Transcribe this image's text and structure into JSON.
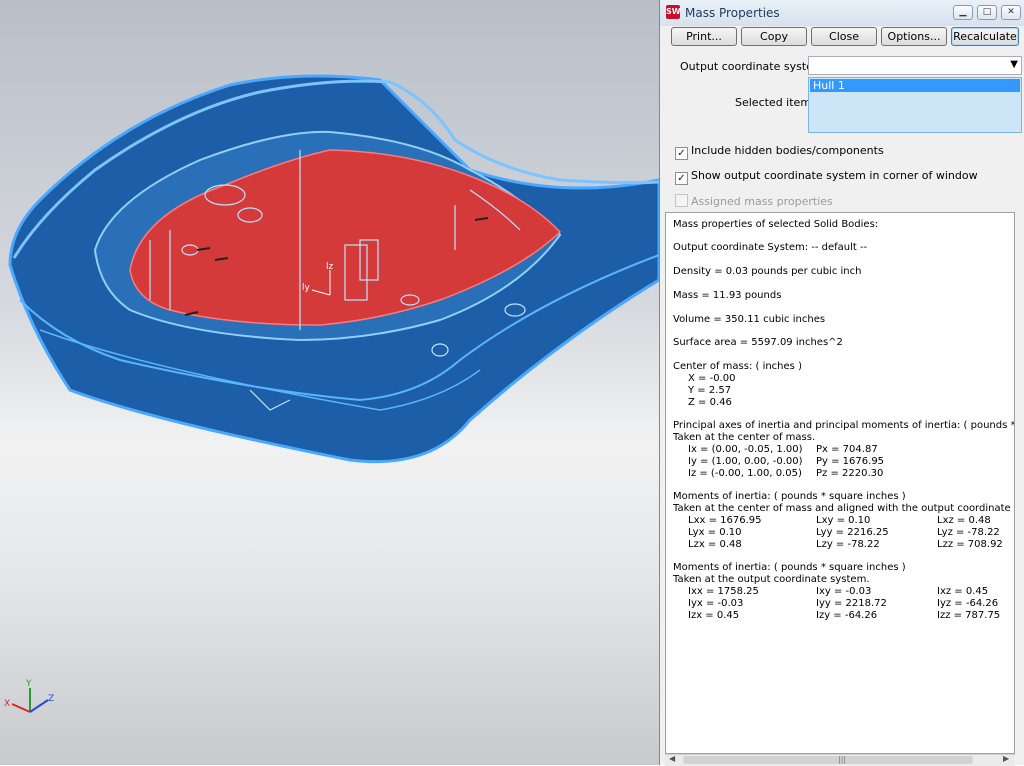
{
  "window": {
    "title": "Mass Properties",
    "app_icon": "SW"
  },
  "toolbar": {
    "print": "Print...",
    "copy": "Copy",
    "close": "Close",
    "options": "Options...",
    "recalculate": "Recalculate"
  },
  "form": {
    "output_coord_label": "Output coordinate system:",
    "output_coord_value": "",
    "selected_items_label": "Selected items:",
    "selected_item": "Hull 1"
  },
  "checkboxes": {
    "include_hidden": "Include hidden bodies/components",
    "show_output": "Show output coordinate system in corner of window",
    "assigned": "Assigned mass properties"
  },
  "report": {
    "header": "Mass properties of selected Solid Bodies:",
    "coord_system": "Output  coordinate System: -- default --",
    "density": "Density = 0.03 pounds per cubic inch",
    "mass": "Mass = 11.93 pounds",
    "volume": "Volume = 350.11 cubic inches",
    "surface": "Surface area = 5597.09 inches^2",
    "com_title": "Center of mass: ( inches )",
    "com_x": "X = -0.00",
    "com_y": "Y = 2.57",
    "com_z": "Z = 0.46",
    "pa_title": "Principal axes of inertia and principal moments of inertia: ( pounds * square inches )",
    "pa_sub": "Taken at the center of mass.",
    "pa_rows": [
      {
        "axis": "Ix = (0.00, -0.05, 1.00)",
        "moment": "Px = 704.87"
      },
      {
        "axis": "Iy = (1.00, 0.00, -0.00)",
        "moment": "Py = 1676.95"
      },
      {
        "axis": "Iz = (-0.00, 1.00, 0.05)",
        "moment": "Pz = 2220.30"
      }
    ],
    "mi1_title": "Moments of inertia: ( pounds * square inches )",
    "mi1_sub": "Taken at the center of mass and aligned with the output coordinate system.",
    "mi1_rows": [
      [
        "Lxx = 1676.95",
        "Lxy = 0.10",
        "Lxz = 0.48"
      ],
      [
        "Lyx = 0.10",
        "Lyy = 2216.25",
        "Lyz = -78.22"
      ],
      [
        "Lzx = 0.48",
        "Lzy = -78.22",
        "Lzz = 708.92"
      ]
    ],
    "mi2_title": "Moments of inertia: ( pounds * square inches )",
    "mi2_sub": "Taken at the output coordinate system.",
    "mi2_rows": [
      [
        "Ixx = 1758.25",
        "Ixy = -0.03",
        "Ixz = 0.45"
      ],
      [
        "Iyx = -0.03",
        "Iyy = 2218.72",
        "Iyz = -64.26"
      ],
      [
        "Izx = 0.45",
        "Izy = -64.26",
        "Izz = 787.75"
      ]
    ]
  },
  "triad": {
    "x": "X",
    "y": "Y",
    "z": "Z"
  },
  "model_labels": {
    "ly": "ly",
    "lz": "lz"
  },
  "colors": {
    "hull_fill": "#1c5fa8",
    "hull_edge": "#4aa8ff",
    "deck_red": "#d43a3a",
    "accent_blue": "#3399ff"
  }
}
